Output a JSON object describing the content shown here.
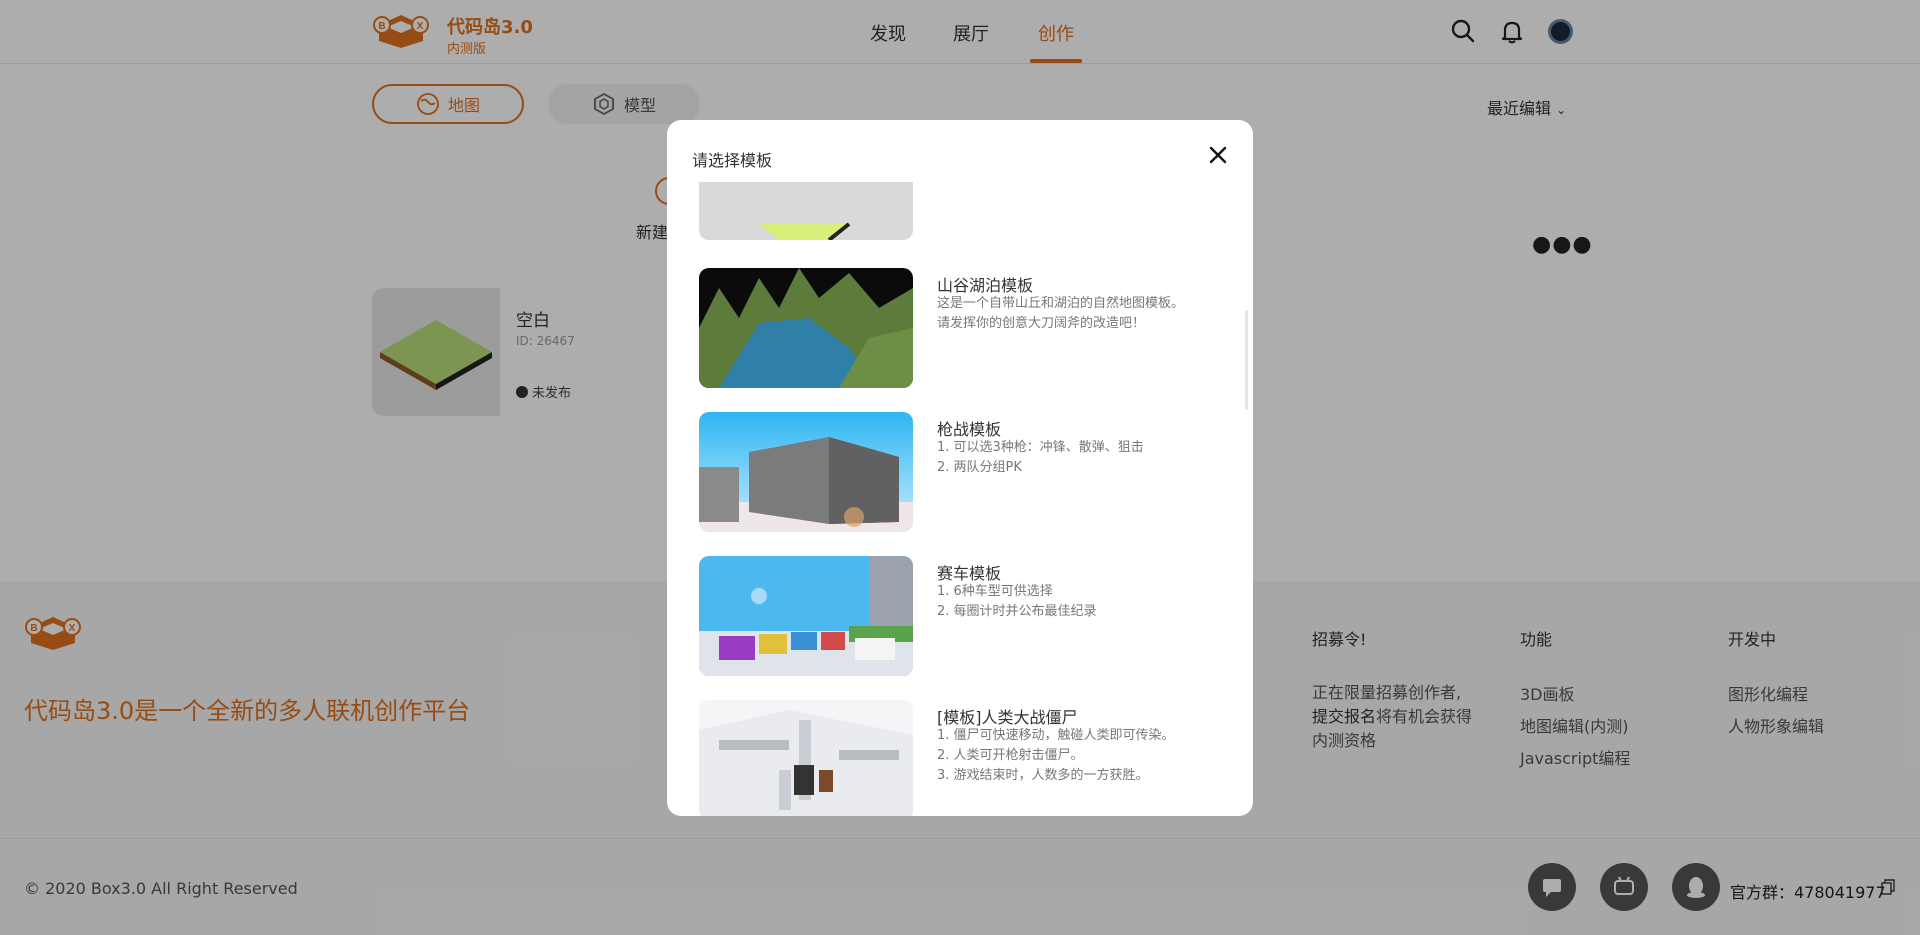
{
  "header": {
    "brand_title": "代码岛3.0",
    "brand_sub": "内测版",
    "nav": [
      {
        "label": "发现"
      },
      {
        "label": "展厅"
      },
      {
        "label": "创作"
      }
    ],
    "active_nav": "创作",
    "icons": [
      "search-icon",
      "bell-icon",
      "avatar"
    ]
  },
  "main": {
    "tabs": [
      {
        "label": "地图",
        "icon": "map-icon"
      },
      {
        "label": "模型",
        "icon": "model-icon"
      }
    ],
    "sort_label": "最近编辑",
    "new_card_label": "新建",
    "project": {
      "name": "空白",
      "id": "ID: 26467",
      "status": "未发布"
    }
  },
  "modal": {
    "title": "请选择模板",
    "templates": [
      {
        "name": "山谷湖泊模板",
        "desc": [
          "这是一个自带山丘和湖泊的自然地图模板。",
          "请发挥你的创意大刀阔斧的改造吧！"
        ]
      },
      {
        "name": "枪战模板",
        "desc": [
          "1. 可以选3种枪：冲锋、散弹、狙击",
          "2. 两队分组PK"
        ]
      },
      {
        "name": "赛车模板",
        "desc": [
          "1. 6种车型可供选择",
          "2. 每圈计时并公布最佳纪录"
        ]
      },
      {
        "name": "[模板]人类大战僵尸",
        "desc": [
          "1. 僵尸可快速移动，触碰人类即可传染。",
          "2. 人类可开枪射击僵尸。",
          "3. 游戏结束时，人数多的一方获胜。"
        ]
      }
    ]
  },
  "footer": {
    "slogan": "代码岛3.0是一个全新的多人联机创作平台",
    "columns": [
      {
        "title": "招募令!"
      },
      {
        "title": "功能",
        "links": [
          "3D画板",
          "地图编辑(内测)",
          "Javascript编程"
        ]
      },
      {
        "title": "开发中",
        "links": [
          "图形化编程",
          "人物形象编辑"
        ]
      }
    ],
    "recruit_text": {
      "a": "正在限量招募创作者,",
      "b": "提交报名",
      "c": "将有机会获得内测资格"
    },
    "copyright": "© 2020 Box3.0 All Right Reserved",
    "qq_group": "官方群：478041977"
  },
  "colors": {
    "accent": "#e0701f",
    "overlay": "rgba(0,0,0,0.32)"
  }
}
